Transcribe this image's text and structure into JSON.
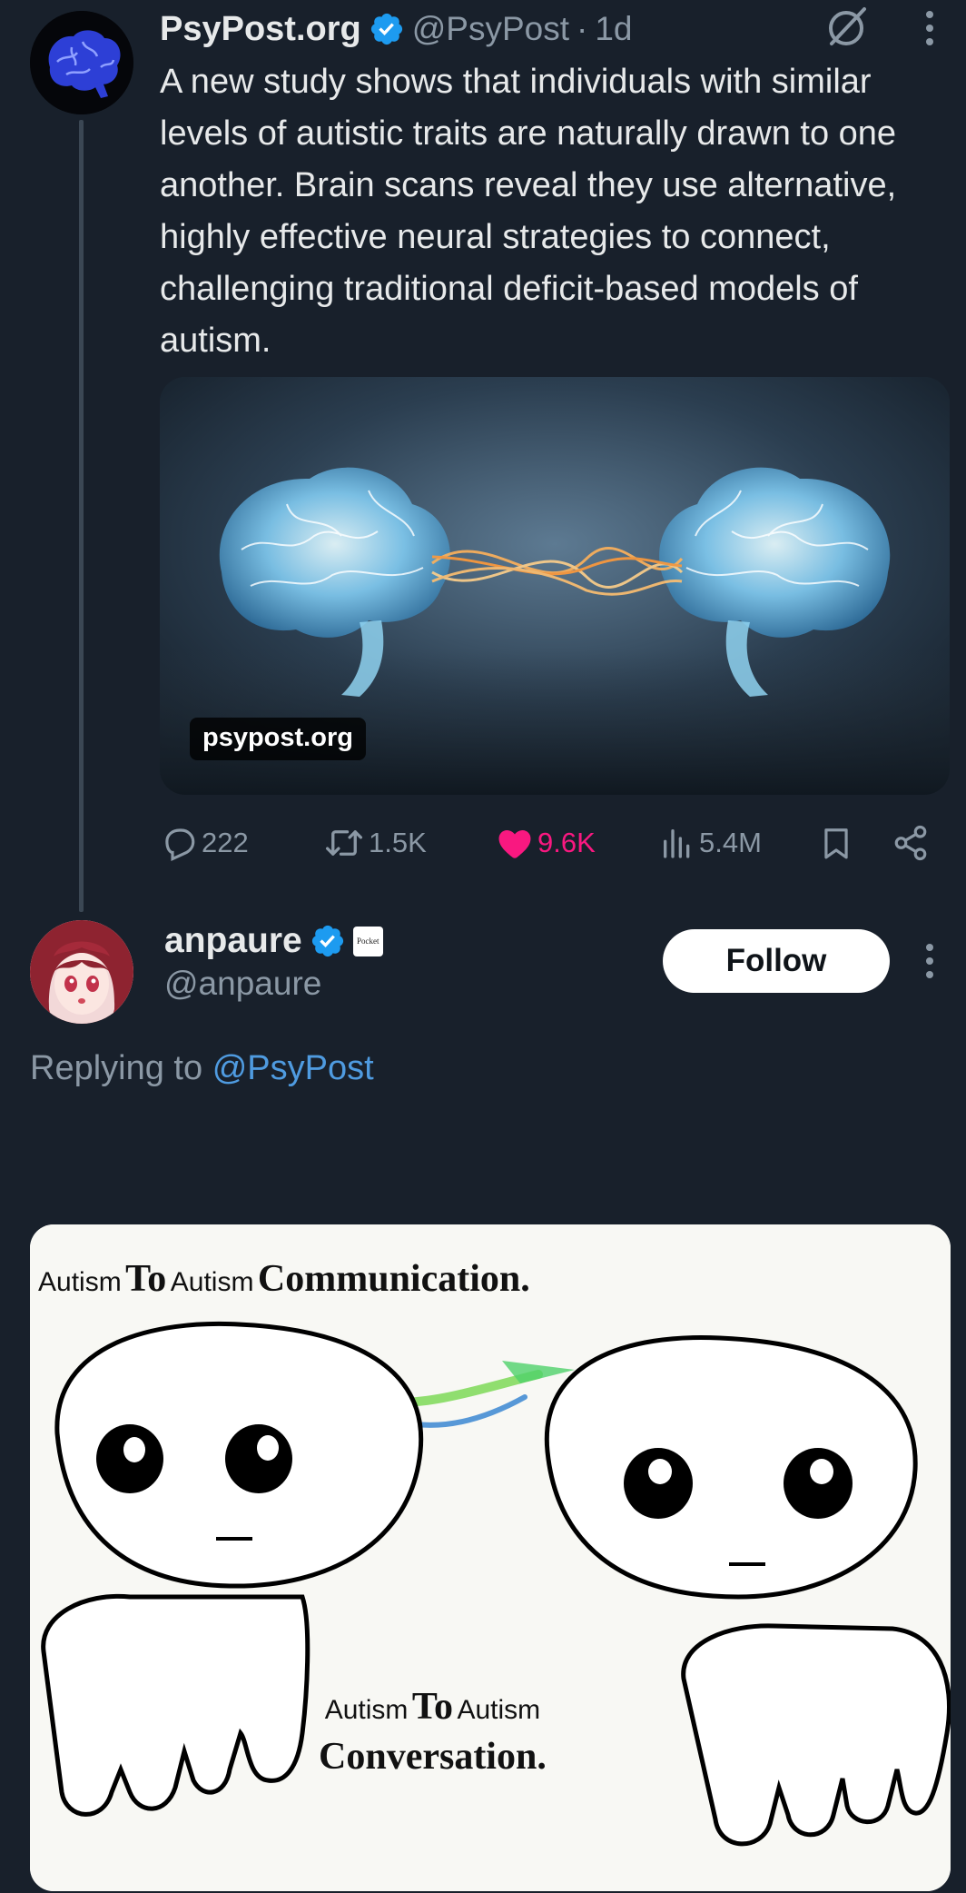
{
  "tweet": {
    "display_name": "PsyPost.org",
    "handle": "@PsyPost",
    "separator": "·",
    "time": "1d",
    "text": "A new study shows that individuals with similar levels of autistic traits are naturally drawn to one another. Brain scans reveal they use alternative, highly effective neural strategies to connect, challenging traditional deficit-based models of autism.",
    "card_domain": "psypost.org",
    "stats": {
      "replies": "222",
      "reposts": "1.5K",
      "likes": "9.6K",
      "views": "5.4M"
    }
  },
  "reply": {
    "display_name": "anpaure",
    "handle": "@anpaure",
    "badge_text": "Pocket",
    "follow_label": "Follow",
    "replying_prefix": "Replying to",
    "replying_mention": "@PsyPost",
    "meme": {
      "top_small_1": "Autism",
      "top_serif_1": "To",
      "top_small_2": "Autism",
      "top_serif_2": "Communication.",
      "mid_small_1": "Autism",
      "mid_serif_1": "To",
      "mid_small_2": "Autism",
      "mid_serif_2": "Conversation."
    }
  },
  "colors": {
    "background": "#18202b",
    "verified": "#1d9bf0",
    "like": "#f91880",
    "mention": "#4f9be0"
  }
}
